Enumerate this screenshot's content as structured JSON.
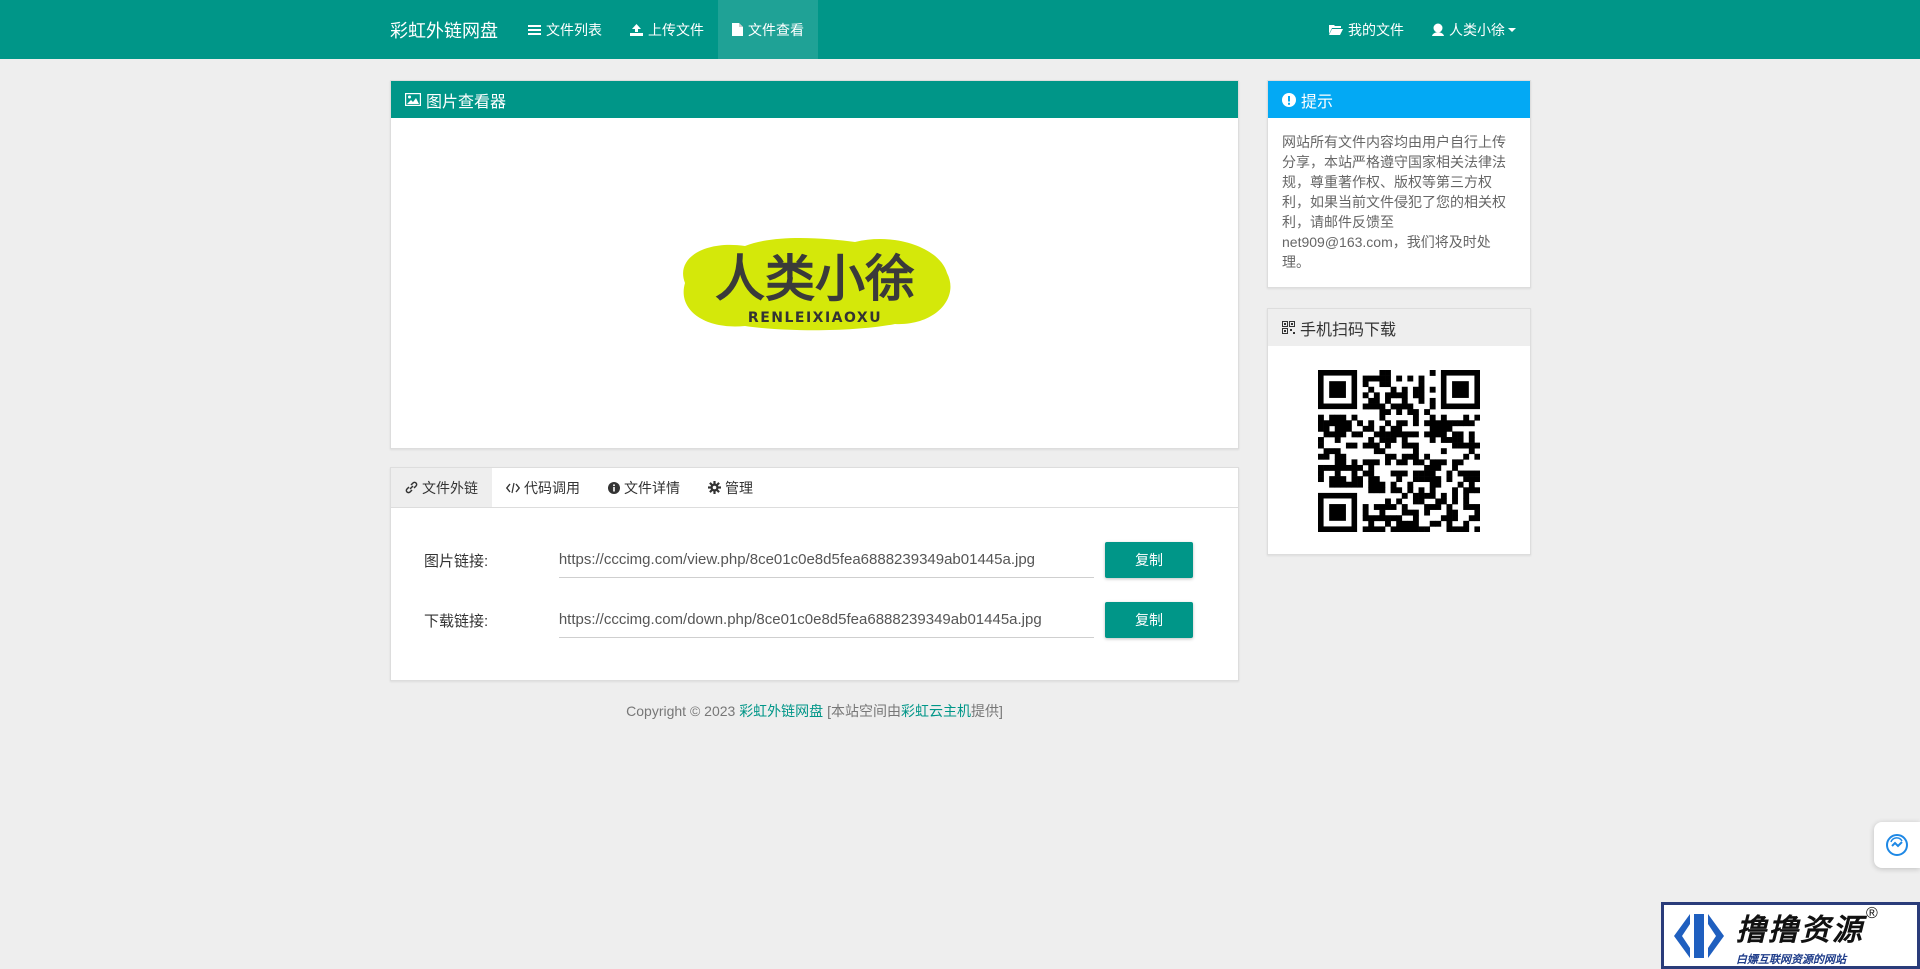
{
  "navbar": {
    "brand": "彩虹外链网盘",
    "items": [
      {
        "label": "文件列表",
        "icon": "list-icon"
      },
      {
        "label": "上传文件",
        "icon": "upload-icon"
      },
      {
        "label": "文件查看",
        "icon": "file-icon",
        "active": true
      }
    ],
    "right": [
      {
        "label": "我的文件",
        "icon": "folder-open-icon"
      },
      {
        "label": "人类小徐",
        "icon": "user-icon",
        "dropdown": true
      }
    ],
    "color": "#009688"
  },
  "viewer": {
    "title": "图片查看器",
    "icon": "image-icon",
    "image": {
      "text_main": "人类小徐",
      "text_sub": "RENLEIXIAOXU"
    }
  },
  "links": {
    "tabs": [
      {
        "label": "文件外链",
        "icon": "link-icon",
        "active": true
      },
      {
        "label": "代码调用",
        "icon": "code-icon"
      },
      {
        "label": "文件详情",
        "icon": "info-icon"
      },
      {
        "label": "管理",
        "icon": "gear-icon"
      }
    ],
    "rows": [
      {
        "label": "图片链接:",
        "value": "https://cccimg.com/view.php/8ce01c0e8d5fea6888239349ab01445a.jpg",
        "button": "复制"
      },
      {
        "label": "下载链接:",
        "value": "https://cccimg.com/down.php/8ce01c0e8d5fea6888239349ab01445a.jpg",
        "button": "复制"
      }
    ]
  },
  "tip": {
    "title": "提示",
    "icon": "exclamation-circle-icon",
    "text": "网站所有文件内容均由用户自行上传分享，本站严格遵守国家相关法律法规，尊重著作权、版权等第三方权利，如果当前文件侵犯了您的相关权利，请邮件反馈至net909@163.com，我们将及时处理。",
    "color": "#03a9f4"
  },
  "qr": {
    "title": "手机扫码下载",
    "icon": "qrcode-icon"
  },
  "footer": {
    "prefix": "Copyright © 2023 ",
    "site": "彩虹外链网盘",
    "mid": " [本站空间由",
    "host": "彩虹云主机",
    "suffix": "提供]"
  },
  "watermark": {
    "title": "撸撸资源",
    "sub": "白嫖互联网资源的网站",
    "mark": "®"
  }
}
